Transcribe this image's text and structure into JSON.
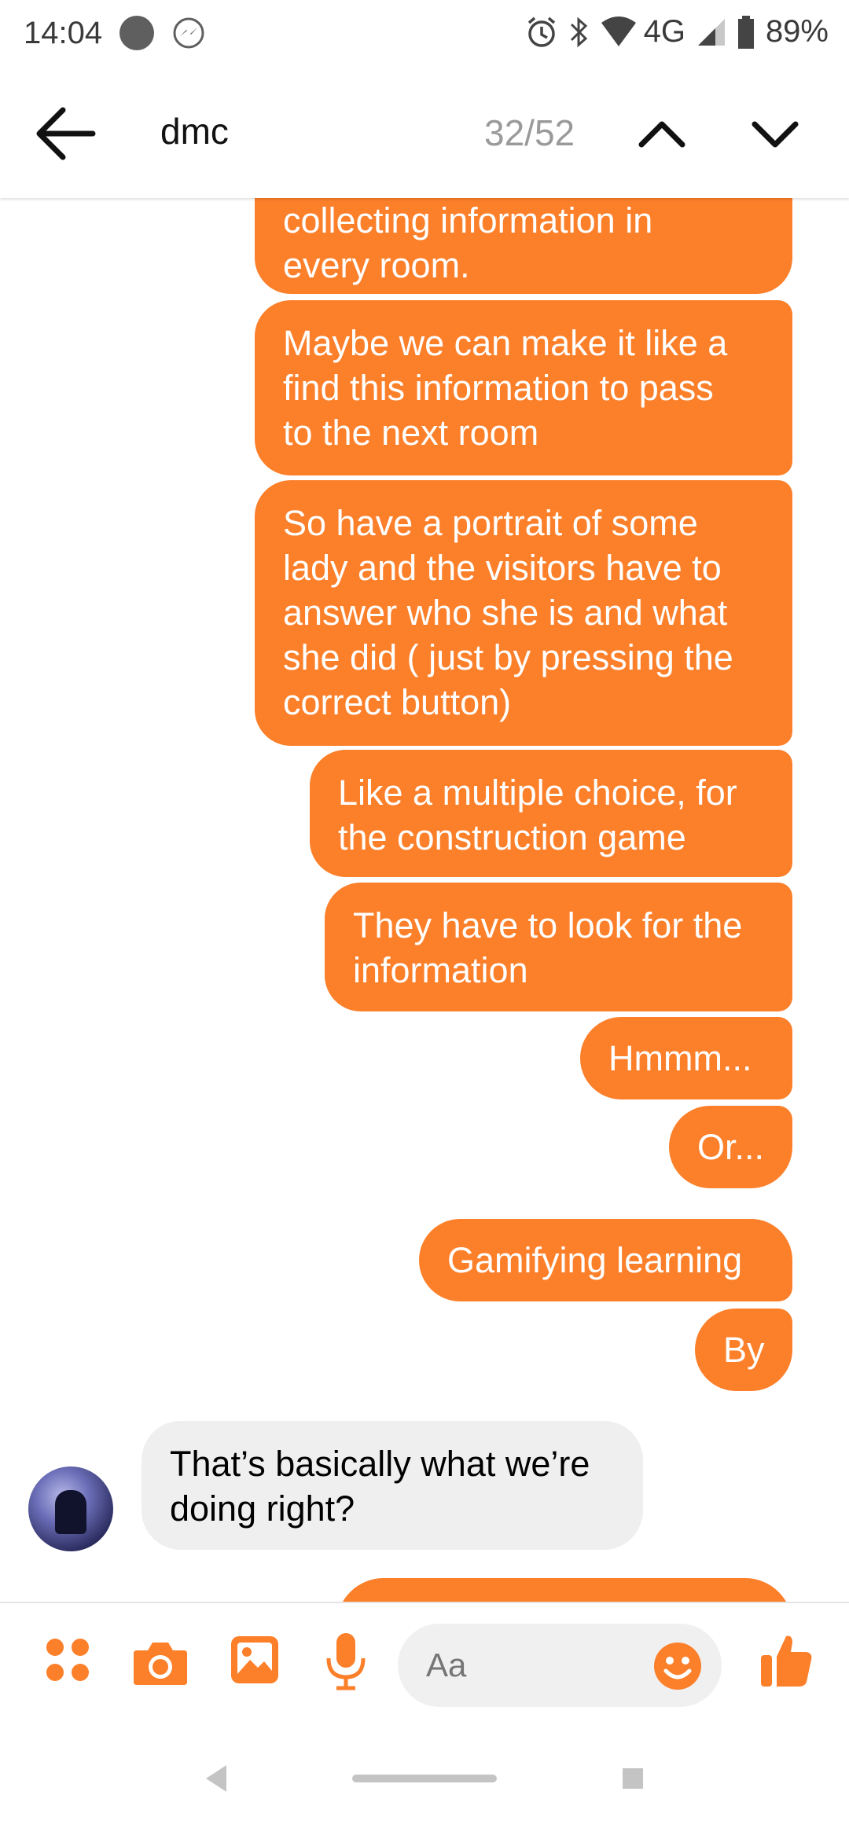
{
  "status_bar": {
    "time": "14:04",
    "network": "4G",
    "battery": "89%"
  },
  "header": {
    "back_icon": "arrow-left-icon",
    "search_query": "dmc",
    "match_count": "32/52",
    "prev_icon": "chevron-up-icon",
    "next_icon": "chevron-down-icon"
  },
  "messages": [
    {
      "sender": "me",
      "text": "collecting information in\nevery room."
    },
    {
      "sender": "me",
      "text": "Maybe we can make it like a\nfind this information to pass\nto the next room"
    },
    {
      "sender": "me",
      "text": "So have a portrait of some\nlady and the visitors have to\nanswer who she is and what\nshe did ( just by pressing the\ncorrect button)"
    },
    {
      "sender": "me",
      "text": "Like a multiple choice, for\nthe construction game"
    },
    {
      "sender": "me",
      "text": "They have to look for the\ninformation"
    },
    {
      "sender": "me",
      "text": "Hmmm..."
    },
    {
      "sender": "me",
      "text": "Or..."
    },
    {
      "sender": "me",
      "text": "Gamifying learning"
    },
    {
      "sender": "me",
      "text": "By"
    },
    {
      "sender": "other",
      "text": "That’s basically what we’re\ndoing right?"
    },
    {
      "sender": "me",
      "text": ""
    }
  ],
  "composer": {
    "placeholder": "Aa",
    "icons": [
      "apps-icon",
      "camera-icon",
      "gallery-icon",
      "microphone-icon",
      "emoji-icon",
      "thumbs-up-icon"
    ]
  },
  "colors": {
    "accent": "#fc7f2a",
    "incoming_bubble": "#efefef"
  }
}
